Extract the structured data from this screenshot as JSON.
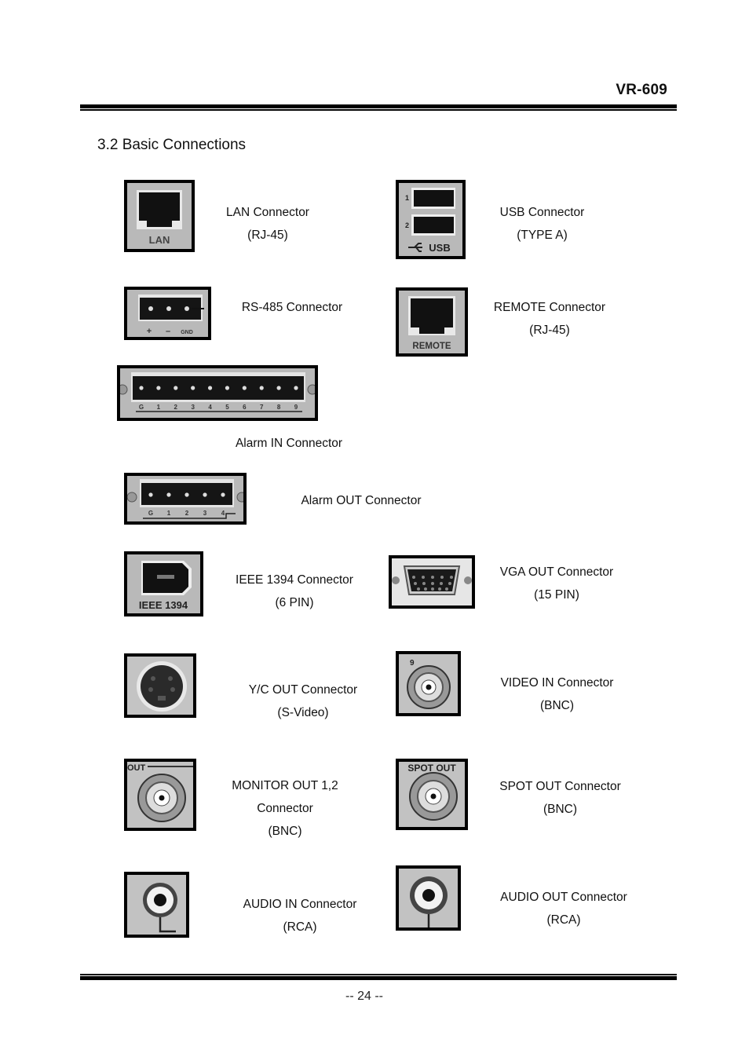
{
  "header": {
    "model": "VR-609"
  },
  "section": {
    "title": "3.2  Basic Connections"
  },
  "connectors": [
    {
      "id": "lan",
      "icon": "rj45-port-icon",
      "panel_label": "LAN",
      "lines": [
        "LAN Connector",
        "(RJ-45)"
      ]
    },
    {
      "id": "usb",
      "icon": "usb-port-icon",
      "panel_label": "USB",
      "port_numbers": [
        "1",
        "2"
      ],
      "lines": [
        "USB Connector",
        "(TYPE A)"
      ]
    },
    {
      "id": "rs485",
      "icon": "terminal-block-icon",
      "panel_marks": [
        "+",
        "–",
        "GND"
      ],
      "lines": [
        "RS-485 Connector"
      ]
    },
    {
      "id": "remote",
      "icon": "rj45-port-icon",
      "panel_label": "REMOTE",
      "lines": [
        "REMOTE Connector",
        "(RJ-45)"
      ]
    },
    {
      "id": "alarm_in",
      "icon": "terminal-block-icon",
      "panel_marks": [
        "G",
        "1",
        "2",
        "3",
        "4",
        "5",
        "6",
        "7",
        "8",
        "9"
      ],
      "lines": [
        "Alarm IN Connector"
      ]
    },
    {
      "id": "alarm_out",
      "icon": "terminal-block-icon",
      "panel_marks": [
        "G",
        "1",
        "2",
        "3",
        "4"
      ],
      "lines": [
        "Alarm OUT Connector"
      ]
    },
    {
      "id": "ieee1394",
      "icon": "firewire-port-icon",
      "panel_label": "IEEE 1394",
      "lines": [
        "IEEE 1394 Connector",
        "(6 PIN)"
      ]
    },
    {
      "id": "vga",
      "icon": "vga-port-icon",
      "lines": [
        "VGA OUT Connector",
        "(15 PIN)"
      ]
    },
    {
      "id": "yc_out",
      "icon": "svideo-port-icon",
      "lines": [
        "Y/C OUT Connector",
        "(S-Video)"
      ]
    },
    {
      "id": "video_in",
      "icon": "bnc-port-icon",
      "panel_label": "9",
      "lines": [
        "VIDEO IN Connector",
        "(BNC)"
      ]
    },
    {
      "id": "monitor_out",
      "icon": "bnc-port-icon",
      "panel_label": "OUT",
      "lines": [
        "MONITOR OUT 1,2",
        "Connector",
        "(BNC)"
      ]
    },
    {
      "id": "spot_out",
      "icon": "bnc-port-icon",
      "panel_label": "SPOT OUT",
      "lines": [
        "SPOT OUT Connector",
        "(BNC)"
      ]
    },
    {
      "id": "audio_in",
      "icon": "rca-port-icon",
      "lines": [
        "AUDIO IN Connector",
        "(RCA)"
      ]
    },
    {
      "id": "audio_out",
      "icon": "rca-port-icon",
      "lines": [
        "AUDIO OUT Connector",
        "(RCA)"
      ]
    }
  ],
  "footer": {
    "page_number": "-- 24 --"
  }
}
